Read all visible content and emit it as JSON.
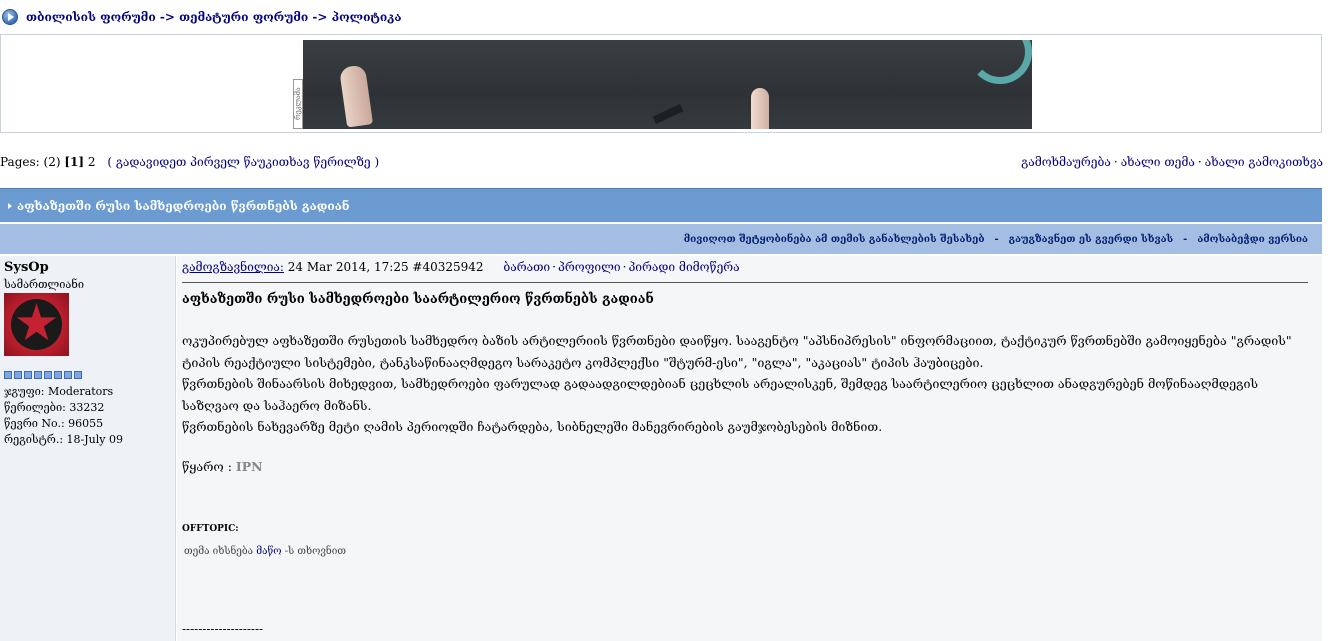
{
  "breadcrumb": {
    "icon": "nav-arrow-icon",
    "trail": "თბილისის ფორუმი -> თემატური ფორუმი -> პოლიტიკა"
  },
  "banner": {
    "ad_tag": "რეკლამა"
  },
  "pagination": {
    "label": "Pages:",
    "total": "(2)",
    "current": "[1]",
    "next": "2",
    "first_unread": "( გადავიდეთ პირველ წაუკითხავ წერილზე )"
  },
  "topic_actions": {
    "reply": "გამოხმაურება",
    "new_topic": "ახალი თემა",
    "new_poll": "ახალი გამოკითხვა",
    "separator": "·"
  },
  "topic": {
    "title": "აფხაზეთში რუსი სამხედროები წვრთნებს გადიან"
  },
  "options": {
    "track": "მივიღოთ შეტყობინება ამ თემის განახლების შესახებ",
    "forward": "გაუგზავნეთ ეს გვერდი სხვას",
    "print": "ამოსაბეჭდი ვერსია",
    "dash": "-"
  },
  "post": {
    "author": {
      "name": "SysOp",
      "title": "სამართლიანი",
      "pip_count": 8,
      "group": "ჯგუფი: Moderators",
      "posts": "წერილები: 33232",
      "member_no": "წევრი No.: 96055",
      "registered": "რეგისტრ.: 18-July 09"
    },
    "header": {
      "posted_label": "გამოგზავნილია:",
      "date": " 24 Mar 2014, 17:25 ",
      "id": " #40325942",
      "card": "ბარათი",
      "profile": "პროფილი",
      "pm": "პირადი მიმოწერა",
      "sep": "·"
    },
    "title": "აფხაზეთში რუსი სამხედროები საარტილერიო წვრთნებს გადიან",
    "paragraphs": [
      "ოკუპირებულ აფხაზეთში რუსეთის სამხედრო ბაზის არტილერიის წვრთნები დაიწყო. სააგენტო \"აპსნიპრესის\" ინფორმაციით, ტაქტიკურ წვრთნებში გამოიყენება \"გრადის\" ტიპის რეაქტიული სისტემები, ტანკსაწინააღმდეგო სარაკეტო კომპლექსი \"შტურმ-ესი\", \"იგლა\", \"აკაციას\" ტიპის ჰაუბიცები.",
      "წვრთნების შინაარსის მიხედვით, სამხედროები ფარულად გადაადგილდებიან ცეცხლის არეალისკენ, შემდეგ საარტილერიო ცეცხლით ანადგურებენ მოწინააღმდეგის საზღვაო და საჰაერო მიზანს.",
      "წვრთნების ნახევარზე მეტი ღამის პერიოდში ჩატარდება, სიბნელეში მანევრირების გაუმჯობესების მიზნით."
    ],
    "source_label": "წყარო : ",
    "source_value": "IPN",
    "offtopic_label": "OFFTOPIC:",
    "offtopic_pre": "თემა იხსნება ",
    "offtopic_user": "მაწო",
    "offtopic_post": " -ს თხოვნით",
    "signature_line": "--------------------"
  },
  "colors": {
    "title_bar": "#6b9bd1",
    "options_bar": "#a3bde3",
    "link": "#000080"
  }
}
